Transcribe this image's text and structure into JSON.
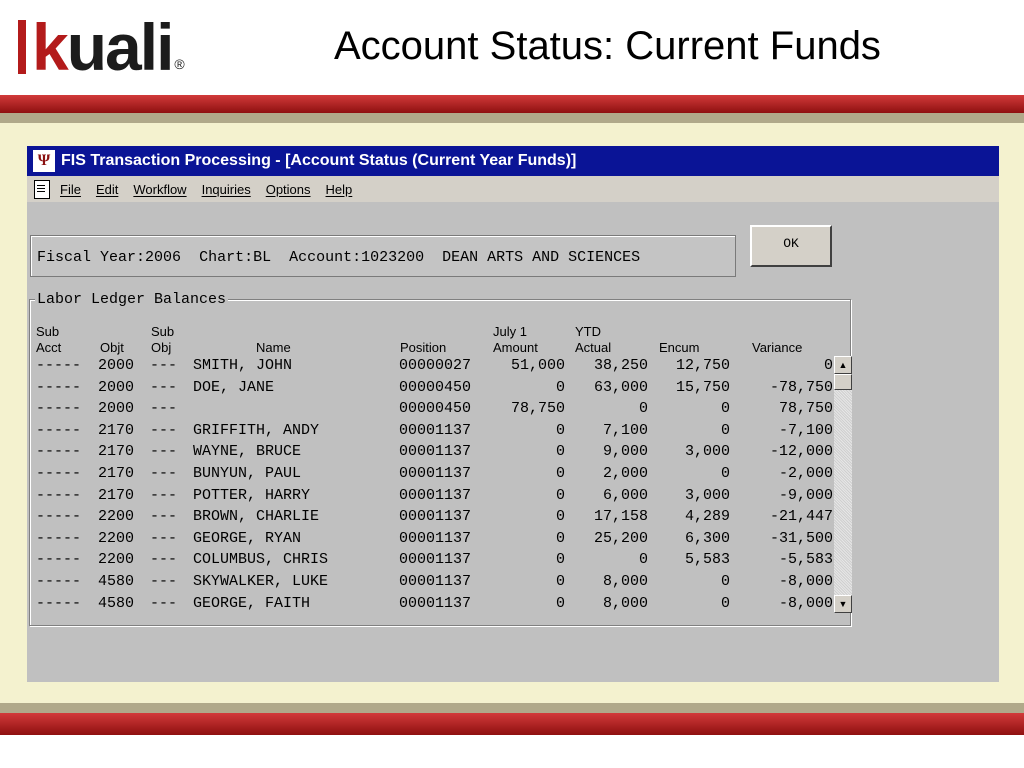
{
  "slide": {
    "logo_text": "kuali",
    "logo_k": "k",
    "logo_rest": "uali",
    "logo_reg": "®",
    "title": "Account Status: Current Funds",
    "colors": {
      "band_red": "#b31b1b",
      "cream": "#f4f2cf",
      "titlebar": "#0a1496"
    }
  },
  "window": {
    "title": "FIS Transaction Processing - [Account Status (Current Year Funds)]",
    "app_icon": "indiana-university-trident-icon",
    "menu": [
      "File",
      "Edit",
      "Workflow",
      "Inquiries",
      "Options",
      "Help"
    ],
    "info": {
      "fiscal_year_label": "Fiscal Year:",
      "fiscal_year": "2006",
      "chart_label": "Chart:",
      "chart": "BL",
      "account_label": "Account:",
      "account": "1023200",
      "account_name": "DEAN ARTS AND SCIENCES"
    },
    "ok_label": "OK",
    "group_title": "Labor Ledger Balances",
    "columns": {
      "sub_acct": [
        "Sub",
        "Acct"
      ],
      "objt": "Objt",
      "sub_obj": [
        "Sub",
        "Obj"
      ],
      "name": "Name",
      "position": "Position",
      "july_amount": [
        "July 1",
        "Amount"
      ],
      "ytd_actual": [
        "YTD",
        "Actual"
      ],
      "encum": "Encum",
      "variance": "Variance"
    },
    "rows": [
      {
        "sub_acct": "-----",
        "objt": "2000",
        "sub_obj": "---",
        "name": "SMITH, JOHN",
        "position": "00000027",
        "july": "51,000",
        "ytd": "38,250",
        "encum": "12,750",
        "variance": "0"
      },
      {
        "sub_acct": "-----",
        "objt": "2000",
        "sub_obj": "---",
        "name": "DOE, JANE",
        "position": "00000450",
        "july": "0",
        "ytd": "63,000",
        "encum": "15,750",
        "variance": "-78,750"
      },
      {
        "sub_acct": "-----",
        "objt": "2000",
        "sub_obj": "---",
        "name": "",
        "position": "00000450",
        "july": "78,750",
        "ytd": "0",
        "encum": "0",
        "variance": "78,750"
      },
      {
        "sub_acct": "-----",
        "objt": "2170",
        "sub_obj": "---",
        "name": "GRIFFITH, ANDY",
        "position": "00001137",
        "july": "0",
        "ytd": "7,100",
        "encum": "0",
        "variance": "-7,100"
      },
      {
        "sub_acct": "-----",
        "objt": "2170",
        "sub_obj": "---",
        "name": "WAYNE, BRUCE",
        "position": "00001137",
        "july": "0",
        "ytd": "9,000",
        "encum": "3,000",
        "variance": "-12,000"
      },
      {
        "sub_acct": "-----",
        "objt": "2170",
        "sub_obj": "---",
        "name": "BUNYUN, PAUL",
        "position": "00001137",
        "july": "0",
        "ytd": "2,000",
        "encum": "0",
        "variance": "-2,000"
      },
      {
        "sub_acct": "-----",
        "objt": "2170",
        "sub_obj": "---",
        "name": "POTTER, HARRY",
        "position": "00001137",
        "july": "0",
        "ytd": "6,000",
        "encum": "3,000",
        "variance": "-9,000"
      },
      {
        "sub_acct": "-----",
        "objt": "2200",
        "sub_obj": "---",
        "name": "BROWN, CHARLIE",
        "position": "00001137",
        "july": "0",
        "ytd": "17,158",
        "encum": "4,289",
        "variance": "-21,447"
      },
      {
        "sub_acct": "-----",
        "objt": "2200",
        "sub_obj": "---",
        "name": "GEORGE, RYAN",
        "position": "00001137",
        "july": "0",
        "ytd": "25,200",
        "encum": "6,300",
        "variance": "-31,500"
      },
      {
        "sub_acct": "-----",
        "objt": "2200",
        "sub_obj": "---",
        "name": "COLUMBUS, CHRIS",
        "position": "00001137",
        "july": "0",
        "ytd": "0",
        "encum": "5,583",
        "variance": "-5,583"
      },
      {
        "sub_acct": "-----",
        "objt": "4580",
        "sub_obj": "---",
        "name": "SKYWALKER, LUKE",
        "position": "00001137",
        "july": "0",
        "ytd": "8,000",
        "encum": "0",
        "variance": "-8,000"
      },
      {
        "sub_acct": "-----",
        "objt": "4580",
        "sub_obj": "---",
        "name": "GEORGE, FAITH",
        "position": "00001137",
        "july": "0",
        "ytd": "8,000",
        "encum": "0",
        "variance": "-8,000"
      }
    ]
  }
}
